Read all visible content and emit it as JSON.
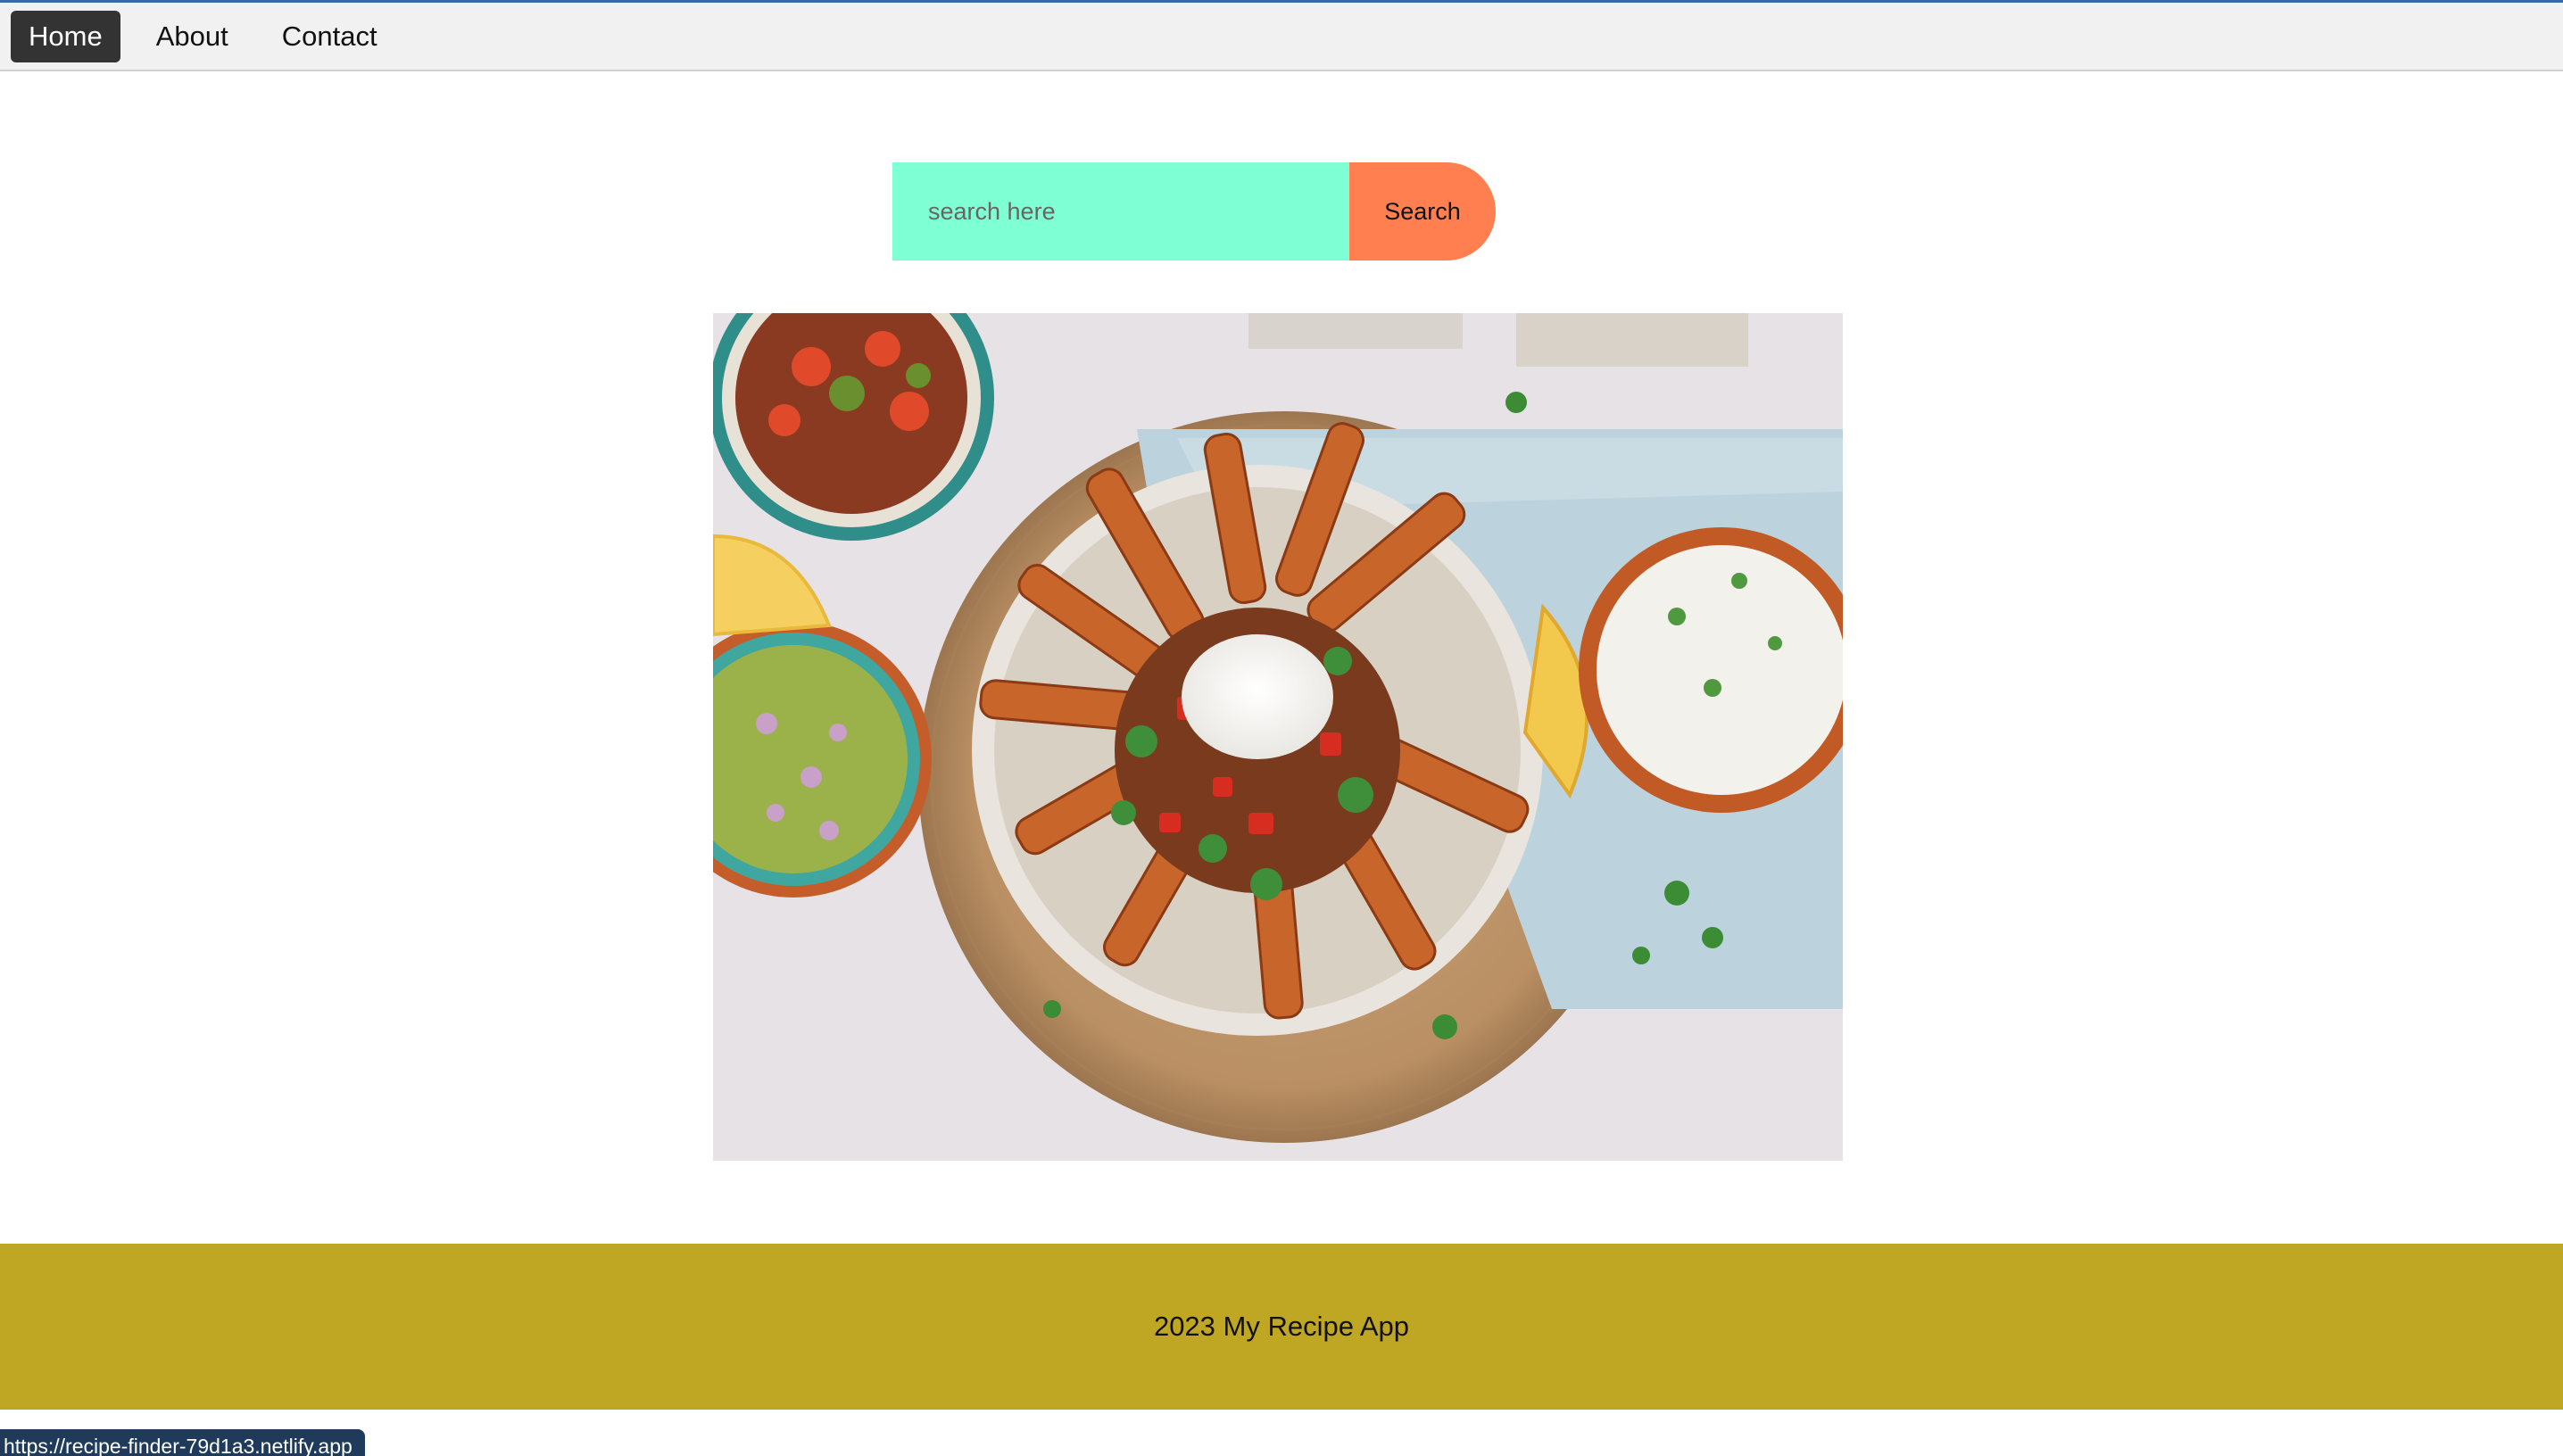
{
  "nav": {
    "items": [
      {
        "label": "Home",
        "active": true
      },
      {
        "label": "About",
        "active": false
      },
      {
        "label": "Contact",
        "active": false
      }
    ]
  },
  "search": {
    "placeholder": "search here",
    "value": "",
    "button_label": "Search"
  },
  "hero": {
    "icon": "food-photo"
  },
  "footer": {
    "text": "2023 My Recipe App"
  },
  "status_bar": {
    "url": "https://recipe-finder-79d1a3.netlify.app"
  },
  "colors": {
    "nav_active_bg": "#333333",
    "search_input_bg": "#7fffd4",
    "search_button_bg": "#ff7f50",
    "footer_bg": "#bfa623"
  }
}
